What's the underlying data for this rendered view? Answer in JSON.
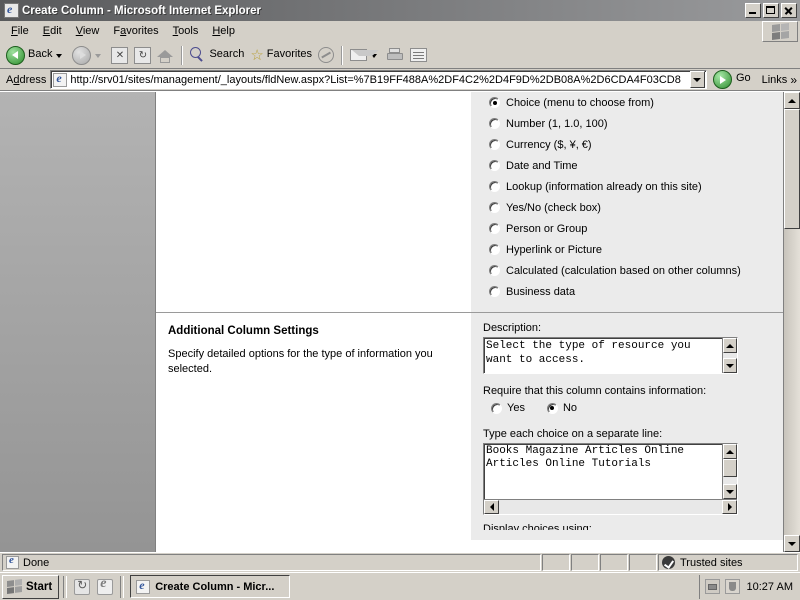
{
  "window": {
    "title": "Create Column - Microsoft Internet Explorer",
    "icon": "ie-document-icon",
    "minimize_label": "Minimize",
    "restore_label": "Restore",
    "close_label": "Close"
  },
  "menubar": {
    "items": [
      {
        "label": "File",
        "accel": "F"
      },
      {
        "label": "Edit",
        "accel": "E"
      },
      {
        "label": "View",
        "accel": "V"
      },
      {
        "label": "Favorites",
        "accel": "a"
      },
      {
        "label": "Tools",
        "accel": "T"
      },
      {
        "label": "Help",
        "accel": "H"
      }
    ],
    "logo": "windows-flag-logo"
  },
  "toolbar": {
    "back_label": "Back",
    "forward_label": "Forward",
    "stop_label": "Stop",
    "refresh_label": "Refresh",
    "home_label": "Home",
    "search_label": "Search",
    "favorites_label": "Favorites",
    "media_label": "Media",
    "mail_label": "Mail",
    "print_label": "Print",
    "edit_label": "Edit"
  },
  "address": {
    "label": "Address",
    "url": "http://srv01/sites/management/_layouts/fldNew.aspx?List=%7B19FF488A%2DF4C2%2D4F9D%2DB08A%2D6CDA4F03CD8",
    "go_label": "Go",
    "links_label": "Links",
    "chevron": "»"
  },
  "page": {
    "column_types": {
      "options": [
        {
          "label": "Choice (menu to choose from)",
          "selected": true
        },
        {
          "label": "Number (1, 1.0, 100)",
          "selected": false
        },
        {
          "label": "Currency ($, ¥, €)",
          "selected": false
        },
        {
          "label": "Date and Time",
          "selected": false
        },
        {
          "label": "Lookup (information already on this site)",
          "selected": false
        },
        {
          "label": "Yes/No (check box)",
          "selected": false
        },
        {
          "label": "Person or Group",
          "selected": false
        },
        {
          "label": "Hyperlink or Picture",
          "selected": false
        },
        {
          "label": "Calculated (calculation based on other columns)",
          "selected": false
        },
        {
          "label": "Business data",
          "selected": false
        }
      ]
    },
    "additional_settings": {
      "title": "Additional Column Settings",
      "description": "Specify detailed options for the type of information you selected.",
      "description_label": "Description:",
      "description_value": "Select the type of resource you want to access.",
      "require_label": "Require that this column contains information:",
      "require_options": [
        {
          "label": "Yes",
          "selected": false
        },
        {
          "label": "No",
          "selected": true
        }
      ],
      "choices_label": "Type each choice on a separate line:",
      "choices_value": "Books\nMagazine Articles\nOnline Articles\nOnline Tutorials",
      "display_choices_label": "Display choices using:"
    }
  },
  "statusbar": {
    "status_text": "Done",
    "zone_text": "Trusted sites",
    "zone_icon": "trusted-sites-icon"
  },
  "taskbar": {
    "start_label": "Start",
    "quick_launch": [
      "refresh-icon",
      "internet-explorer-icon"
    ],
    "tasks": [
      {
        "label": "Create Column - Micr...",
        "icon": "ie-document-icon"
      }
    ],
    "tray_icons": [
      "network-icon",
      "security-icon"
    ],
    "clock": "10:27 AM"
  }
}
